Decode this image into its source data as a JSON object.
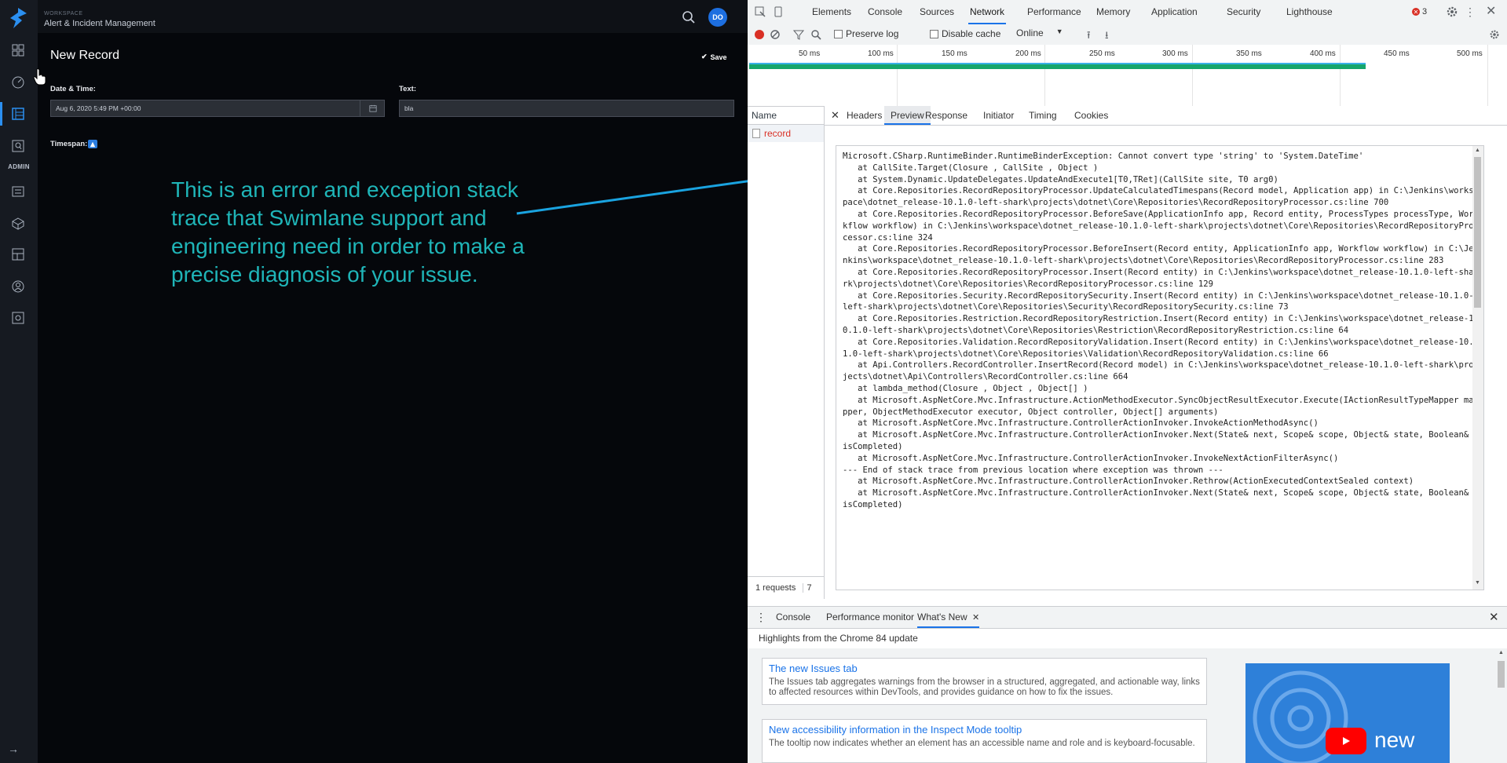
{
  "app": {
    "workspace_label": "WORKSPACE",
    "workspace_name": "Alert & Incident Management",
    "avatar_initials": "DO",
    "admin_label": "ADMIN",
    "record_title": "New Record",
    "save_label": "Save",
    "fields": {
      "datetime_label": "Date & Time:",
      "datetime_value": "Aug 6, 2020 5:49 PM +00:00",
      "text_label": "Text:",
      "text_value": "bla",
      "timespan_label": "Timespan:"
    },
    "annotation": "This is an error and exception stack trace that Swimlane support and engineering need in order to make a precise diagnosis of your issue.",
    "colors": {
      "accent": "#2b8ff0",
      "annotation": "#1fb5b8",
      "background": "#05070b"
    }
  },
  "devtools": {
    "main_tabs": [
      "Elements",
      "Console",
      "Sources",
      "Network",
      "Performance",
      "Memory",
      "Application",
      "Security",
      "Lighthouse"
    ],
    "active_tab": "Network",
    "error_count": "3",
    "toolbar": {
      "preserve_log": "Preserve log",
      "disable_cache": "Disable cache",
      "throttling": "Online"
    },
    "timeline_ticks": [
      "50 ms",
      "100 ms",
      "150 ms",
      "200 ms",
      "250 ms",
      "300 ms",
      "350 ms",
      "400 ms",
      "450 ms",
      "500 ms"
    ],
    "name_header": "Name",
    "request_name": "record",
    "detail_tabs": [
      "Headers",
      "Preview",
      "Response",
      "Initiator",
      "Timing",
      "Cookies"
    ],
    "active_detail_tab": "Preview",
    "status_bar": "1 requests",
    "status_bar_trailing": "7",
    "preview_text": "Microsoft.CSharp.RuntimeBinder.RuntimeBinderException: Cannot convert type 'string' to 'System.DateTime'\n   at CallSite.Target(Closure , CallSite , Object )\n   at System.Dynamic.UpdateDelegates.UpdateAndExecute1[T0,TRet](CallSite site, T0 arg0)\n   at Core.Repositories.RecordRepositoryProcessor.UpdateCalculatedTimespans(Record model, Application app) in C:\\Jenkins\\workspace\\dotnet_release-10.1.0-left-shark\\projects\\dotnet\\Core\\Repositories\\RecordRepositoryProcessor.cs:line 700\n   at Core.Repositories.RecordRepositoryProcessor.BeforeSave(ApplicationInfo app, Record entity, ProcessTypes processType, Workflow workflow) in C:\\Jenkins\\workspace\\dotnet_release-10.1.0-left-shark\\projects\\dotnet\\Core\\Repositories\\RecordRepositoryProcessor.cs:line 324\n   at Core.Repositories.RecordRepositoryProcessor.BeforeInsert(Record entity, ApplicationInfo app, Workflow workflow) in C:\\Jenkins\\workspace\\dotnet_release-10.1.0-left-shark\\projects\\dotnet\\Core\\Repositories\\RecordRepositoryProcessor.cs:line 283\n   at Core.Repositories.RecordRepositoryProcessor.Insert(Record entity) in C:\\Jenkins\\workspace\\dotnet_release-10.1.0-left-shark\\projects\\dotnet\\Core\\Repositories\\RecordRepositoryProcessor.cs:line 129\n   at Core.Repositories.Security.RecordRepositorySecurity.Insert(Record entity) in C:\\Jenkins\\workspace\\dotnet_release-10.1.0-left-shark\\projects\\dotnet\\Core\\Repositories\\Security\\RecordRepositorySecurity.cs:line 73\n   at Core.Repositories.Restriction.RecordRepositoryRestriction.Insert(Record entity) in C:\\Jenkins\\workspace\\dotnet_release-10.1.0-left-shark\\projects\\dotnet\\Core\\Repositories\\Restriction\\RecordRepositoryRestriction.cs:line 64\n   at Core.Repositories.Validation.RecordRepositoryValidation.Insert(Record entity) in C:\\Jenkins\\workspace\\dotnet_release-10.1.0-left-shark\\projects\\dotnet\\Core\\Repositories\\Validation\\RecordRepositoryValidation.cs:line 66\n   at Api.Controllers.RecordController.InsertRecord(Record model) in C:\\Jenkins\\workspace\\dotnet_release-10.1.0-left-shark\\projects\\dotnet\\Api\\Controllers\\RecordController.cs:line 664\n   at lambda_method(Closure , Object , Object[] )\n   at Microsoft.AspNetCore.Mvc.Infrastructure.ActionMethodExecutor.SyncObjectResultExecutor.Execute(IActionResultTypeMapper mapper, ObjectMethodExecutor executor, Object controller, Object[] arguments)\n   at Microsoft.AspNetCore.Mvc.Infrastructure.ControllerActionInvoker.InvokeActionMethodAsync()\n   at Microsoft.AspNetCore.Mvc.Infrastructure.ControllerActionInvoker.Next(State& next, Scope& scope, Object& state, Boolean& isCompleted)\n   at Microsoft.AspNetCore.Mvc.Infrastructure.ControllerActionInvoker.InvokeNextActionFilterAsync()\n--- End of stack trace from previous location where exception was thrown ---\n   at Microsoft.AspNetCore.Mvc.Infrastructure.ControllerActionInvoker.Rethrow(ActionExecutedContextSealed context)\n   at Microsoft.AspNetCore.Mvc.Infrastructure.ControllerActionInvoker.Next(State& next, Scope& scope, Object& state, Boolean& isCompleted)",
    "drawer_tabs": [
      "Console",
      "Performance monitor",
      "What's New"
    ],
    "active_drawer_tab": "What's New",
    "whats_new_heading": "Highlights from the Chrome 84 update",
    "cards": [
      {
        "title": "The new Issues tab",
        "body": "The Issues tab aggregates warnings from the browser in a structured, aggregated, and actionable way, links to affected resources within DevTools, and provides guidance on how to fix the issues."
      },
      {
        "title": "New accessibility information in the Inspect Mode tooltip",
        "body": "The tooltip now indicates whether an element has an accessible name and role and is keyboard-focusable."
      }
    ],
    "promo_word": "new",
    "colors": {
      "active_tab": "#1a73e8",
      "error": "#d93025",
      "timeline_bar": "#16a66c"
    }
  }
}
